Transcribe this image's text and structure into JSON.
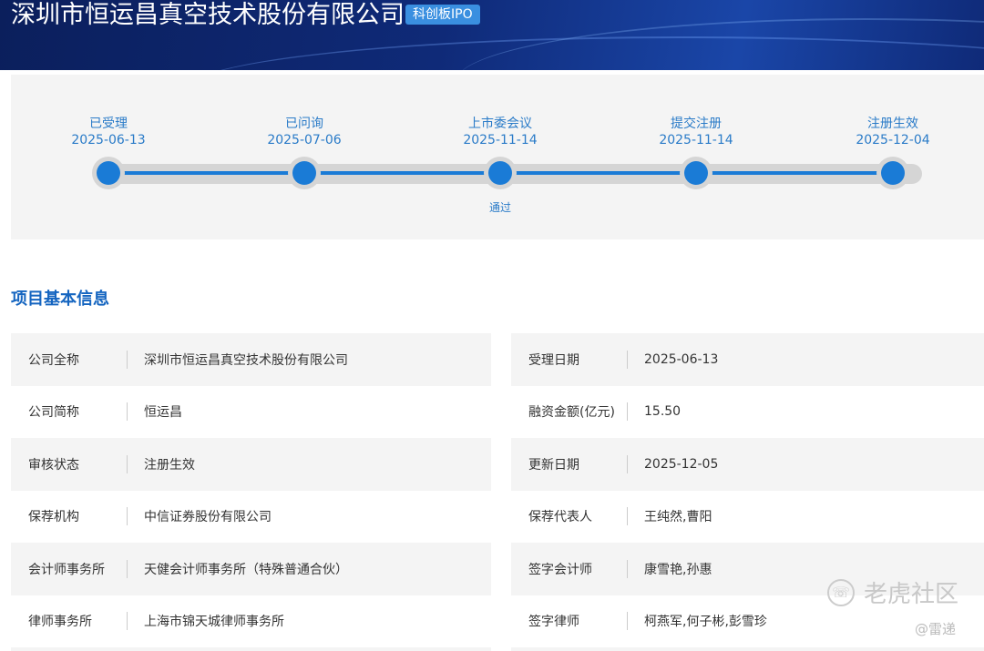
{
  "header": {
    "title": "深圳市恒运昌真空技术股份有限公司",
    "badge": "科创板IPO"
  },
  "timeline": [
    {
      "label": "已受理",
      "date": "2025-06-13",
      "note": ""
    },
    {
      "label": "已问询",
      "date": "2025-07-06",
      "note": ""
    },
    {
      "label": "上市委会议",
      "date": "2025-11-14",
      "note": "通过"
    },
    {
      "label": "提交注册",
      "date": "2025-11-14",
      "note": ""
    },
    {
      "label": "注册生效",
      "date": "2025-12-04",
      "note": ""
    }
  ],
  "section_title": "项目基本信息",
  "left": [
    {
      "k": "公司全称",
      "v": "深圳市恒运昌真空技术股份有限公司"
    },
    {
      "k": "公司简称",
      "v": "恒运昌"
    },
    {
      "k": "审核状态",
      "v": "注册生效"
    },
    {
      "k": "保荐机构",
      "v": "中信证券股份有限公司"
    },
    {
      "k": "会计师事务所",
      "v": "天健会计师事务所（特殊普通合伙）"
    },
    {
      "k": "律师事务所",
      "v": "上海市锦天城律师事务所"
    }
  ],
  "right": [
    {
      "k": "受理日期",
      "v": "2025-06-13"
    },
    {
      "k": "融资金额(亿元)",
      "v": "15.50"
    },
    {
      "k": "更新日期",
      "v": "2025-12-05"
    },
    {
      "k": "保荐代表人",
      "v": "王纯然,曹阳"
    },
    {
      "k": "签字会计师",
      "v": "康雪艳,孙惠"
    },
    {
      "k": "签字律师",
      "v": "柯燕军,何子彬,彭雪珍"
    }
  ],
  "watermark": {
    "brand": "老虎社区",
    "author": "@雷递"
  }
}
